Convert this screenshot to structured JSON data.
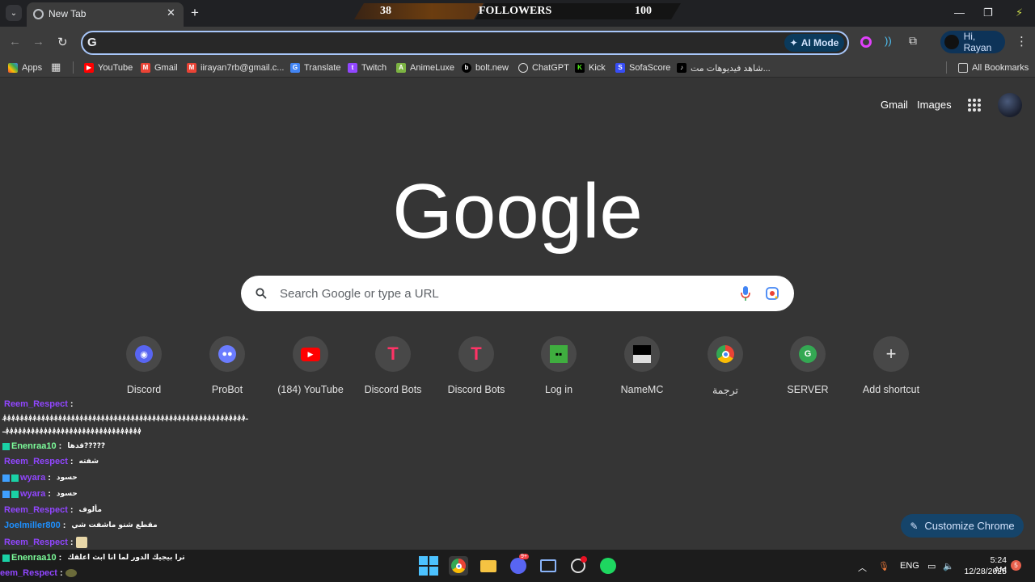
{
  "browser": {
    "tab_title": "New Tab",
    "new_tab_label": "+",
    "close_label": "✕",
    "omnibox_value": "",
    "ai_mode_label": "AI Mode",
    "profile_label": "Hi, Rayan"
  },
  "overlay": {
    "left_count": "38",
    "title": "FOLLOWERS",
    "right_count": "100"
  },
  "bookmarks": {
    "items": [
      "Apps",
      "YouTube",
      "Gmail",
      "iirayan7rb@gmail.c...",
      "Translate",
      "Twitch",
      "AnimeLuxe",
      "bolt.new",
      "ChatGPT",
      "Kick",
      "SofaScore",
      "شاهد فيديوهات مت..."
    ],
    "all_bookmarks": "All Bookmarks"
  },
  "header": {
    "gmail": "Gmail",
    "images": "Images"
  },
  "logo_text": "Google",
  "search": {
    "placeholder": "Search Google or type a URL"
  },
  "shortcuts": [
    "Discord",
    "ProBot",
    "(184) YouTube",
    "Discord Bots",
    "Discord Bots",
    "Log in",
    "NameMC",
    "ترجمة",
    "SERVER",
    "Add shortcut"
  ],
  "chat": [
    {
      "name": "Reem_Respect",
      "msg": ""
    },
    {
      "name": "",
      "msg": "ـ؋؋؋؋؋؋؋؋؋؋؋؋؋؋؋؋؋؋؋؋؋؋؋؋؋؋؋؋؋؋؋؋؋؋؋؋؋؋؋؋؋؋؋؋؋؋؋؋؋؋؋؋؋؋؋؋؋"
    },
    {
      "name": "",
      "msg": "؋؋؋؋؋؋؋؋؋؋؋؋؋؋؋؋؋؋؋؋؋؋؋؋؋؋؋؋؋؋؋؋ـ"
    },
    {
      "name": "Enenraa10",
      "msg": "قدها?????"
    },
    {
      "name": "Reem_Respect",
      "msg": "شفته"
    },
    {
      "name": "wyara",
      "msg": "حسود"
    },
    {
      "name": "wyara",
      "msg": "حسود"
    },
    {
      "name": "Reem_Respect",
      "msg": "مألوف"
    },
    {
      "name": "Joelmiller800",
      "msg": "مقطع شنو ماشفت شي"
    },
    {
      "name": "Reem_Respect",
      "msg": ""
    },
    {
      "name": "Enenraa10",
      "msg": "ترا بيجيك الدور لما انا ابث اعلقك"
    },
    {
      "name": "eem_Respect",
      "msg": ""
    }
  ],
  "customize_label": "Customize Chrome",
  "taskbar": {
    "lang": "ENG",
    "time": "5:24 AM",
    "date": "12/28/2025",
    "notif_count": "5",
    "discord_badge": "9+"
  }
}
